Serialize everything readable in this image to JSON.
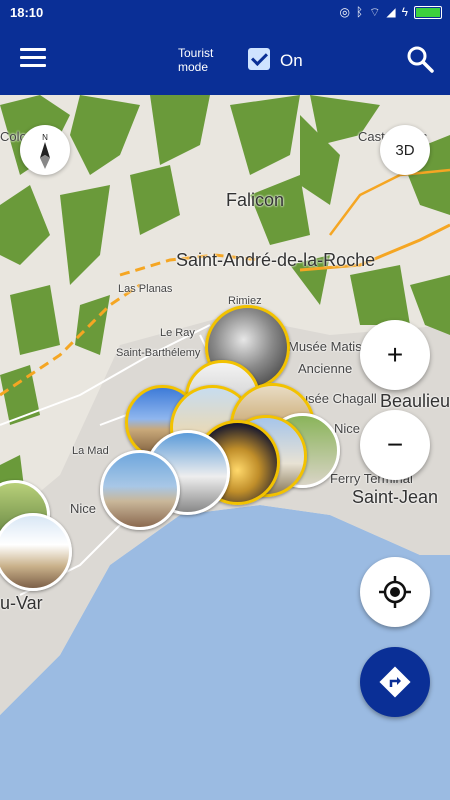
{
  "status_bar": {
    "time": "18:10",
    "icons": [
      "headset-icon",
      "bluetooth-icon",
      "wifi-icon",
      "signal-icon",
      "charging-icon",
      "battery-icon"
    ]
  },
  "app_bar": {
    "tourist_mode_label": "Tourist mode",
    "tourist_toggle_label": "On",
    "tourist_toggle_checked": true,
    "menu_icon": "hamburger-menu-icon",
    "search_icon": "search-icon"
  },
  "map": {
    "labels": {
      "colomars": "Colomars",
      "castagniers": "Castagniers",
      "falicon": "Falicon",
      "saint_andre": "Saint-André-de-la-Roche",
      "las_planas": "Las Planas",
      "rimiez": "Rimiez",
      "le_ray": "Le Ray",
      "saint_barthelemy": "Saint-Barthélemy",
      "matisse": "Musée Matisse",
      "ancienne": "Ancienne",
      "chagall": "Musée Chagall",
      "beaulieu": "Beaulieu",
      "nice": "Nice",
      "la_madeleine": "La Mad",
      "nice_port": "Nice",
      "terminal": "Ferry Terminal",
      "saint_jean": "Saint-Jean",
      "var": "u-Var"
    },
    "controls": {
      "compass_label": "N",
      "view_3d_label": "3D",
      "zoom_in_label": "+",
      "zoom_out_label": "−"
    },
    "colors": {
      "land": "#e9e6df",
      "vegetation": "#6a9a3a",
      "sea": "#9bbbe2",
      "highway": "#f5a623",
      "accent": "#0a2f96",
      "photo_border": "#f2c200"
    }
  }
}
